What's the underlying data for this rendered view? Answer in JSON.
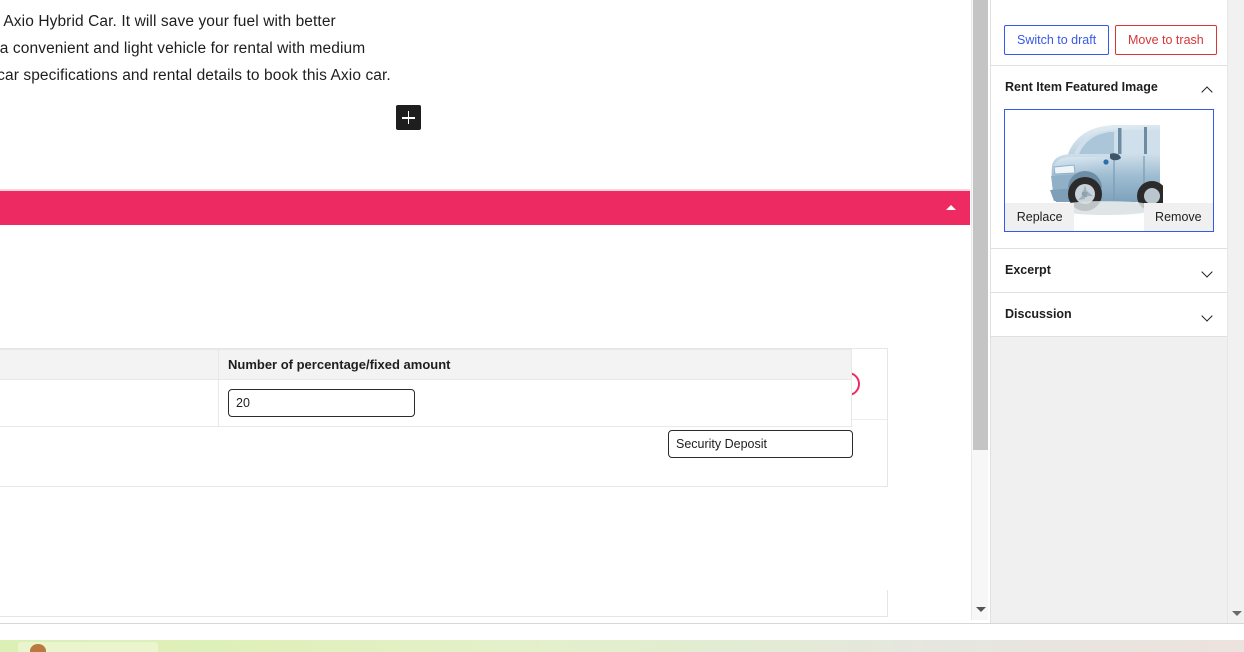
{
  "editor": {
    "post_copy_lines": [
      "lla Axio Hybrid Car. It will save your fuel with better",
      "is a convenient and light vehicle for rental with medium",
      "e car specifications and rental details to book this Axio car."
    ],
    "inserter_label": "+",
    "section_bar": {
      "title": "",
      "collapse_icon": "caret-up-icon",
      "color": "#ee2a62"
    },
    "settings": {
      "toggle": {
        "state": "on",
        "color": "#ee2a62"
      },
      "deposit_field": {
        "value": "Security Deposit",
        "placeholder": "Security Deposit"
      },
      "table": {
        "headers": [
          "",
          "Number of percentage/fixed amount"
        ],
        "rows": [
          {
            "cell_a": "",
            "amount_value": "20",
            "amount_placeholder": ""
          }
        ]
      }
    }
  },
  "sidebar": {
    "actions": {
      "switch_to_draft": "Switch to draft",
      "move_to_trash": "Move to trash"
    },
    "panels": [
      {
        "title": "Rent Item Featured Image",
        "state": "expanded",
        "chevron": "chevron-up-icon"
      },
      {
        "title": "Excerpt",
        "state": "collapsed",
        "chevron": "chevron-down-icon"
      },
      {
        "title": "Discussion",
        "state": "collapsed",
        "chevron": "chevron-down-icon"
      }
    ],
    "featured_image": {
      "alt": "blue toyota corolla axio hybrid car",
      "replace_label": "Replace",
      "remove_label": "Remove"
    }
  },
  "scrollbars": {
    "inner_down_arrow": "scroll-down-icon",
    "outer_down_arrow": "scroll-down-icon"
  },
  "colors": {
    "accent_pink": "#ee2a62",
    "link_blue": "#3858e9",
    "danger_red": "#d63638"
  }
}
